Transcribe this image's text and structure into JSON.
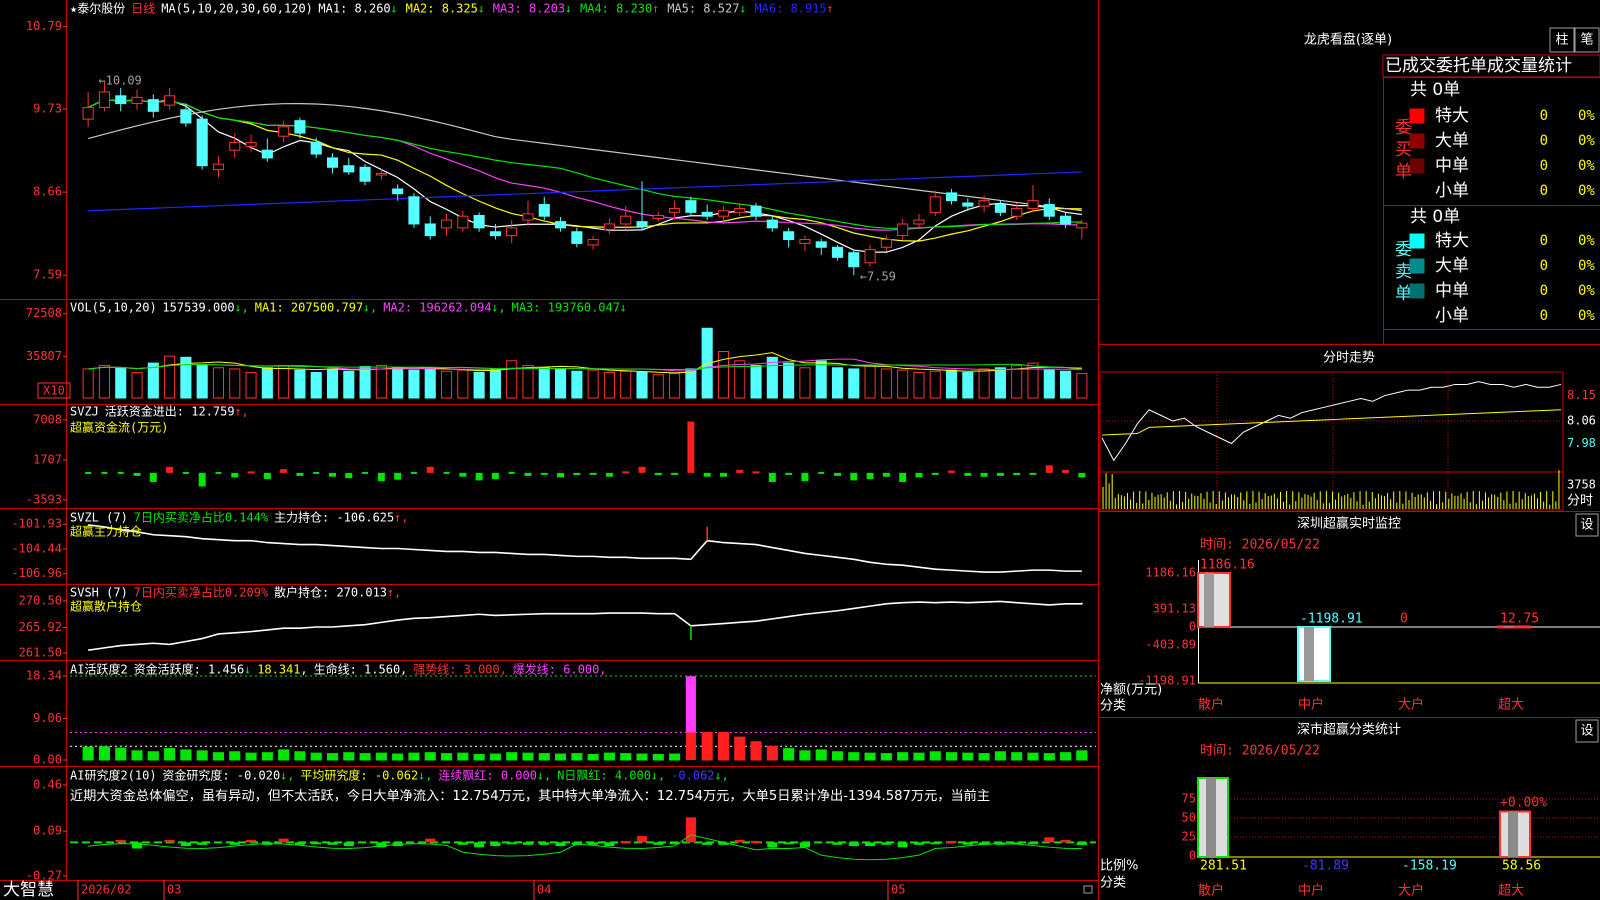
{
  "colors": {
    "up": "#ff3232",
    "down": "#54ffff",
    "ma1": "#ffffff",
    "ma2": "#ffff00",
    "ma3": "#ff3cff",
    "ma4": "#00e600",
    "ma5": "#c8c8c8",
    "ma6": "#1e28ff",
    "frame": "#c80000",
    "axis": "#ff3232",
    "green": "#00e600",
    "yellow": "#ffff00",
    "magenta": "#ff3cff",
    "cyan": "#54ffff",
    "grey": "#a0a0a0",
    "blue": "#3c3cff"
  },
  "stock": {
    "name": "★泰尔股份",
    "period": "日线"
  },
  "candle": {
    "ma_label": "MA(5,10,20,30,60,120)",
    "ma_items": [
      {
        "text": "MA1: 8.260",
        "arrow": "↓",
        "color": "#ffffff",
        "arrow_color": "#00e600"
      },
      {
        "text": "MA2: 8.325",
        "arrow": "↓",
        "color": "#ffff00",
        "arrow_color": "#00e600"
      },
      {
        "text": "MA3: 8.203",
        "arrow": "↓",
        "color": "#ff3cff",
        "arrow_color": "#00e600"
      },
      {
        "text": "MA4: 8.230",
        "arrow": "↑",
        "color": "#00e600",
        "arrow_color": "#ff3232"
      },
      {
        "text": "MA5: 8.527",
        "arrow": "↓",
        "color": "#c8c8c8",
        "arrow_color": "#00e600"
      },
      {
        "text": "MA6: 8.915",
        "arrow": "↑",
        "color": "#1e28ff",
        "arrow_color": "#ff3232"
      }
    ],
    "y_labels": [
      "10.79",
      "9.73",
      "8.66",
      "7.59"
    ],
    "high_note": "←10.09",
    "low_note": "←7.59"
  },
  "vol": {
    "title": "VOL(5,10,20)",
    "value": "157539.000",
    "ma1": "MA1: 207500.797",
    "ma2": "MA2: 196262.094",
    "ma3": "MA3: 193760.047",
    "y_labels": [
      "72508",
      "35807"
    ],
    "unit": "X10"
  },
  "svzj": {
    "title": "SVZJ",
    "desc": "活跃资金进出: 12.759",
    "subtitle": "超赢资金流(万元)",
    "y_labels": [
      "7008",
      "1707",
      "-3593"
    ]
  },
  "svzl": {
    "title": "SVZL (7)",
    "desc": "7日内买卖净占比0.144%",
    "desc2": "主力持仓: -106.625",
    "subtitle": "超赢主力持仓",
    "y_labels": [
      "-101.93",
      "-104.44",
      "-106.96"
    ]
  },
  "svsh": {
    "title": "SVSH (7)",
    "desc": "7日内买卖净占比0.209%",
    "desc2": "散户持仓: 270.013",
    "subtitle": "超赢散户持仓",
    "y_labels": [
      "270.50",
      "265.92",
      "261.50"
    ]
  },
  "ai1": {
    "title": "AI活跃度2",
    "items": [
      {
        "text": "资金活跃度: 1.456",
        "color": "#ffffff",
        "arrow": "↓",
        "arrow_color": "#00e600"
      },
      {
        "text": "18.341",
        "color": "#ffff00",
        "arrow": ",",
        "arrow_color": "#ffffff"
      },
      {
        "text": "生命线: 1.560",
        "color": "#ffffff",
        "arrow": ",",
        "arrow_color": "#ffffff"
      },
      {
        "text": "强势线: 3.000",
        "color": "#ff3232",
        "arrow": ",",
        "arrow_color": "#ff3232"
      },
      {
        "text": "爆发线: 6.000",
        "color": "#ff3cff",
        "arrow": ",",
        "arrow_color": "#ff3cff"
      }
    ],
    "y_labels": [
      "18.34",
      "9.06",
      "0.00"
    ]
  },
  "ai2": {
    "title": "AI研究度2(10)",
    "items": [
      {
        "text": "资金研究度: -0.020",
        "color": "#ffffff",
        "arrow": "↓",
        "arrow_color": "#00e600"
      },
      {
        "text": "平均研究度: -0.062",
        "color": "#ffff00",
        "arrow": "↓",
        "arrow_color": "#00e600"
      },
      {
        "text": "连续飘红: 0.000",
        "color": "#ff3cff",
        "arrow": "↓",
        "arrow_color": "#00e600"
      },
      {
        "text": "N日飘红: 4.000",
        "color": "#00e600",
        "arrow": "↓",
        "arrow_color": "#00e600"
      },
      {
        "text": "-0.062",
        "color": "#3c3cff",
        "arrow": "↓",
        "arrow_color": "#00e600"
      }
    ],
    "comment": "近期大资金总体偏空，虽有异动，但不太活跃，今日大单净流入：12.754万元，其中特大单净流入：12.754万元，大单5日累计净出-1394.587万元，当前主",
    "y_labels": [
      "0.46",
      "0.09",
      "-0.27"
    ]
  },
  "bottom": {
    "brand": "大智慧",
    "dates": [
      "2026/02",
      "03",
      "04",
      "05"
    ]
  },
  "dragon": {
    "title": "龙虎看盘(逐单)",
    "btn1": "柱",
    "btn2": "笔",
    "header": "已成交委托单成交量统计",
    "buy_label": "委买单",
    "sell_label": "委卖单",
    "buy_total": "共 0单",
    "sell_total": "共 0单",
    "buy_rows": [
      {
        "label": "特大",
        "count": "0",
        "pct": "0%",
        "color": "#ff0000"
      },
      {
        "label": "大单",
        "count": "0",
        "pct": "0%",
        "color": "#8c0000"
      },
      {
        "label": "中单",
        "count": "0",
        "pct": "0%",
        "color": "#6e0000"
      },
      {
        "label": "小单",
        "count": "0",
        "pct": "0%",
        "color": "#000000"
      }
    ],
    "sell_rows": [
      {
        "label": "特大",
        "count": "0",
        "pct": "0%",
        "color": "#00ffff"
      },
      {
        "label": "大单",
        "count": "0",
        "pct": "0%",
        "color": "#008c8c"
      },
      {
        "label": "中单",
        "count": "0",
        "pct": "0%",
        "color": "#007070"
      },
      {
        "label": "小单",
        "count": "0",
        "pct": "0%",
        "color": "#000000"
      }
    ]
  },
  "fenshi": {
    "title": "分时走势",
    "y_labels": [
      "8.15",
      "8.06",
      "7.98"
    ],
    "vol_label": "3758",
    "unit": "分时"
  },
  "monitor": {
    "title": "深圳超赢实时监控",
    "btn": "设",
    "time": "时间: 2026/05/22",
    "y_labels": [
      "1186.16",
      "391.13",
      "0",
      "-403.89",
      "-1198.91"
    ],
    "axis_label1": "净额(万元)",
    "axis_label2": "分类",
    "categories": [
      "散户",
      "中户",
      "大户",
      "超大"
    ],
    "values": [
      1186.16,
      -1198.91,
      0,
      12.75
    ],
    "value_labels": [
      "1186.16",
      "-1198.91",
      "0",
      "12.75"
    ]
  },
  "classify": {
    "title": "深市超赢分类统计",
    "btn": "设",
    "time": "时间: 2026/05/22",
    "y_labels": [
      "75",
      "50",
      "25",
      "0"
    ],
    "axis_label1": "比例%",
    "axis_label2": "分类",
    "categories": [
      "散户",
      "中户",
      "大户",
      "超大"
    ],
    "values": [
      281.51,
      -81.89,
      -158.19,
      58.56
    ],
    "value_labels": [
      "281.51",
      "-81.89",
      "-158.19",
      "58.56"
    ],
    "pct_note": "+0.00%"
  },
  "chart_data": [
    {
      "type": "candlestick",
      "title": "泰尔股份 日线",
      "ylim": [
        7.4,
        10.85
      ],
      "x_labels": [
        "2026/02",
        "03",
        "04",
        "05"
      ],
      "candles": [
        [
          9.6,
          9.75,
          9.95,
          9.5
        ],
        [
          9.75,
          9.95,
          10.09,
          9.7
        ],
        [
          9.9,
          9.8,
          10.0,
          9.7
        ],
        [
          9.8,
          9.88,
          9.98,
          9.72
        ],
        [
          9.85,
          9.7,
          9.92,
          9.62
        ],
        [
          9.78,
          9.9,
          10.0,
          9.72
        ],
        [
          9.72,
          9.55,
          9.8,
          9.5
        ],
        [
          9.6,
          9.0,
          9.65,
          8.95
        ],
        [
          8.95,
          9.02,
          9.12,
          8.85
        ],
        [
          9.2,
          9.3,
          9.42,
          9.1
        ],
        [
          9.25,
          9.3,
          9.4,
          9.18
        ],
        [
          9.2,
          9.1,
          9.35,
          9.05
        ],
        [
          9.38,
          9.5,
          9.58,
          9.3
        ],
        [
          9.58,
          9.42,
          9.62,
          9.35
        ],
        [
          9.3,
          9.15,
          9.36,
          9.1
        ],
        [
          9.1,
          8.98,
          9.16,
          8.9
        ],
        [
          9.0,
          8.92,
          9.1,
          8.88
        ],
        [
          8.98,
          8.8,
          9.02,
          8.75
        ],
        [
          8.88,
          8.9,
          8.96,
          8.82
        ],
        [
          8.7,
          8.64,
          8.76,
          8.55
        ],
        [
          8.6,
          8.25,
          8.65,
          8.2
        ],
        [
          8.25,
          8.1,
          8.35,
          8.05
        ],
        [
          8.2,
          8.3,
          8.38,
          8.1
        ],
        [
          8.2,
          8.35,
          8.42,
          8.15
        ],
        [
          8.36,
          8.2,
          8.4,
          8.15
        ],
        [
          8.15,
          8.1,
          8.25,
          8.05
        ],
        [
          8.1,
          8.2,
          8.3,
          8.0
        ],
        [
          8.3,
          8.38,
          8.55,
          8.22
        ],
        [
          8.5,
          8.35,
          8.6,
          8.3
        ],
        [
          8.28,
          8.2,
          8.34,
          8.15
        ],
        [
          8.15,
          8.0,
          8.2,
          7.95
        ],
        [
          7.98,
          8.05,
          8.1,
          7.92
        ],
        [
          8.18,
          8.25,
          8.32,
          8.12
        ],
        [
          8.25,
          8.35,
          8.48,
          8.18
        ],
        [
          8.28,
          8.22,
          8.8,
          8.18
        ],
        [
          8.32,
          8.36,
          8.4,
          8.28
        ],
        [
          8.4,
          8.45,
          8.55,
          8.3
        ],
        [
          8.55,
          8.4,
          8.6,
          8.35
        ],
        [
          8.4,
          8.35,
          8.5,
          8.3
        ],
        [
          8.35,
          8.42,
          8.48,
          8.25
        ],
        [
          8.4,
          8.45,
          8.52,
          8.35
        ],
        [
          8.48,
          8.35,
          8.52,
          8.3
        ],
        [
          8.3,
          8.2,
          8.35,
          8.15
        ],
        [
          8.15,
          8.05,
          8.2,
          7.95
        ],
        [
          8.0,
          8.05,
          8.1,
          7.9
        ],
        [
          8.02,
          7.95,
          8.06,
          7.85
        ],
        [
          7.95,
          7.82,
          7.98,
          7.78
        ],
        [
          7.88,
          7.7,
          7.92,
          7.59
        ],
        [
          7.75,
          7.92,
          7.98,
          7.7
        ],
        [
          7.95,
          8.05,
          8.1,
          7.9
        ],
        [
          8.1,
          8.25,
          8.32,
          8.05
        ],
        [
          8.25,
          8.3,
          8.38,
          8.2
        ],
        [
          8.4,
          8.6,
          8.68,
          8.35
        ],
        [
          8.65,
          8.55,
          8.7,
          8.5
        ],
        [
          8.52,
          8.48,
          8.58,
          8.42
        ],
        [
          8.48,
          8.55,
          8.62,
          8.4
        ],
        [
          8.5,
          8.4,
          8.55,
          8.35
        ],
        [
          8.35,
          8.45,
          8.52,
          8.3
        ],
        [
          8.45,
          8.55,
          8.75,
          8.4
        ],
        [
          8.5,
          8.35,
          8.58,
          8.3
        ],
        [
          8.35,
          8.25,
          8.4,
          8.2
        ],
        [
          8.2,
          8.26,
          8.3,
          8.05
        ]
      ]
    },
    {
      "type": "bar",
      "title": "VOL(5,10,20)",
      "ylim": [
        0,
        80000
      ],
      "values": [
        25000,
        28000,
        26000,
        22000,
        30000,
        36000,
        35000,
        28000,
        26000,
        25000,
        22000,
        26000,
        28000,
        24000,
        22000,
        25000,
        23000,
        27000,
        28000,
        26000,
        24000,
        25000,
        23000,
        24000,
        22000,
        25000,
        32000,
        28000,
        26000,
        25000,
        23000,
        24000,
        22000,
        23000,
        22000,
        20000,
        21000,
        25000,
        60000,
        40000,
        32000,
        28000,
        35000,
        30000,
        26000,
        32000,
        26000,
        25000,
        28000,
        25000,
        24000,
        22000,
        23000,
        24000,
        22000,
        25000,
        26000,
        28000,
        30000,
        24000,
        23000,
        21000
      ]
    },
    {
      "type": "bar",
      "title": "SVZJ",
      "ylim": [
        -3593,
        7008
      ],
      "values": [
        0,
        0,
        0,
        -400,
        -1200,
        800,
        0,
        -1800,
        0,
        -600,
        200,
        -800,
        500,
        -400,
        0,
        -500,
        -700,
        0,
        -1100,
        -900,
        0,
        800,
        0,
        -500,
        -1000,
        -800,
        0,
        -400,
        -200,
        -600,
        -300,
        -200,
        -500,
        200,
        800,
        -300,
        -200,
        6800,
        -500,
        -500,
        400,
        200,
        -1200,
        -200,
        -1100,
        0,
        -400,
        -1000,
        -800,
        -500,
        -1200,
        -600,
        -200,
        300,
        -400,
        -500,
        -400,
        -300,
        -200,
        1000,
        400,
        -600
      ]
    },
    {
      "type": "line",
      "title": "SVZL",
      "ylim": [
        -107.4,
        -101.5
      ],
      "values": [
        -102.0,
        -102.2,
        -102.5,
        -102.7,
        -103.0,
        -103.1,
        -103.2,
        -103.4,
        -103.5,
        -103.6,
        -103.6,
        -103.8,
        -103.9,
        -104.0,
        -104.0,
        -104.1,
        -104.2,
        -104.3,
        -104.4,
        -104.4,
        -104.5,
        -104.6,
        -104.7,
        -104.7,
        -104.8,
        -104.8,
        -104.9,
        -105.0,
        -105.0,
        -105.1,
        -105.2,
        -105.2,
        -105.3,
        -105.3,
        -105.4,
        -105.4,
        -105.4,
        -105.5,
        -103.6,
        -103.8,
        -103.9,
        -104.0,
        -104.3,
        -104.6,
        -104.9,
        -105.1,
        -105.3,
        -105.5,
        -105.8,
        -106.0,
        -106.1,
        -106.3,
        -106.5,
        -106.6,
        -106.7,
        -106.8,
        -106.8,
        -106.7,
        -106.6,
        -106.6,
        -106.7,
        -106.7
      ]
    },
    {
      "type": "line",
      "title": "SVSH",
      "ylim": [
        261.0,
        271.0
      ],
      "values": [
        262.0,
        262.4,
        262.8,
        263.0,
        263.2,
        263.0,
        263.5,
        264.0,
        264.8,
        265.0,
        265.2,
        265.5,
        265.8,
        265.8,
        266.0,
        266.0,
        266.2,
        266.4,
        266.8,
        267.2,
        267.5,
        267.6,
        267.8,
        268.0,
        268.2,
        268.0,
        268.1,
        268.2,
        268.3,
        268.3,
        268.3,
        268.3,
        268.4,
        268.4,
        268.4,
        268.3,
        268.3,
        266.2,
        266.4,
        266.6,
        266.8,
        267.0,
        267.4,
        267.8,
        268.2,
        268.5,
        268.8,
        269.2,
        269.6,
        270.0,
        270.2,
        270.3,
        270.2,
        270.3,
        270.2,
        270.3,
        270.4,
        270.2,
        270.0,
        269.8,
        270.0,
        270.0,
        270.2
      ]
    },
    {
      "type": "bar",
      "title": "AI活跃度2",
      "ylim": [
        0,
        18.34
      ],
      "values": [
        2.8,
        2.9,
        2.6,
        2.0,
        1.8,
        2.5,
        2.2,
        2.0,
        1.6,
        1.8,
        1.5,
        1.6,
        2.2,
        1.8,
        1.5,
        1.4,
        1.6,
        1.4,
        1.5,
        1.3,
        1.5,
        1.6,
        1.4,
        1.5,
        1.2,
        1.3,
        1.6,
        1.5,
        1.4,
        1.3,
        1.4,
        1.2,
        1.5,
        1.4,
        1.3,
        1.2,
        1.3,
        18.3,
        6.0,
        6.0,
        5.0,
        4.0,
        3.0,
        2.5,
        2.0,
        2.2,
        1.8,
        1.6,
        1.5,
        1.4,
        1.6,
        1.5,
        1.8,
        1.6,
        1.5,
        1.4,
        1.8,
        1.6,
        1.5,
        1.4,
        1.6,
        2.0,
        1.5
      ]
    },
    {
      "type": "bar",
      "title": "AI研究度2(10)",
      "ylim": [
        -0.27,
        0.46
      ],
      "values": [
        0.0,
        0.0,
        0.02,
        -0.05,
        0.0,
        0.02,
        -0.03,
        -0.02,
        0.0,
        -0.02,
        0.02,
        -0.02,
        0.03,
        -0.02,
        -0.01,
        -0.02,
        -0.03,
        0.0,
        -0.04,
        -0.03,
        0.0,
        0.03,
        0.0,
        -0.02,
        -0.04,
        -0.03,
        -0.01,
        -0.02,
        -0.02,
        -0.03,
        -0.02,
        -0.02,
        -0.03,
        0.01,
        0.05,
        -0.02,
        -0.01,
        0.2,
        -0.02,
        -0.02,
        0.02,
        0.01,
        -0.04,
        -0.01,
        -0.04,
        0.0,
        -0.02,
        -0.03,
        -0.03,
        -0.02,
        -0.04,
        -0.02,
        -0.01,
        0.01,
        -0.02,
        -0.02,
        -0.02,
        -0.01,
        -0.01,
        0.04,
        0.02,
        -0.02,
        -0.02
      ]
    },
    {
      "type": "line",
      "title": "分时走势",
      "ylim": [
        7.9,
        8.22
      ],
      "values": [
        8.0,
        7.92,
        7.98,
        8.05,
        8.1,
        8.08,
        8.06,
        8.07,
        8.04,
        8.02,
        8.0,
        7.98,
        8.02,
        8.04,
        8.06,
        8.08,
        8.07,
        8.09,
        8.1,
        8.11,
        8.12,
        8.13,
        8.14,
        8.13,
        8.15,
        8.16,
        8.17,
        8.17,
        8.18,
        8.18,
        8.19,
        8.19,
        8.2,
        8.19,
        8.19,
        8.18,
        8.19,
        8.18,
        8.18,
        8.19
      ]
    },
    {
      "type": "bar",
      "title": "深圳超赢实时监控",
      "categories": [
        "散户",
        "中户",
        "大户",
        "超大"
      ],
      "values": [
        1186.16,
        -1198.91,
        0,
        12.75
      ],
      "ylim": [
        -1198.91,
        1186.16
      ]
    },
    {
      "type": "bar",
      "title": "深市超赢分类统计",
      "categories": [
        "散户",
        "中户",
        "大户",
        "超大"
      ],
      "values": [
        281.51,
        -81.89,
        -158.19,
        58.56
      ],
      "ylim": [
        0,
        75
      ]
    }
  ]
}
